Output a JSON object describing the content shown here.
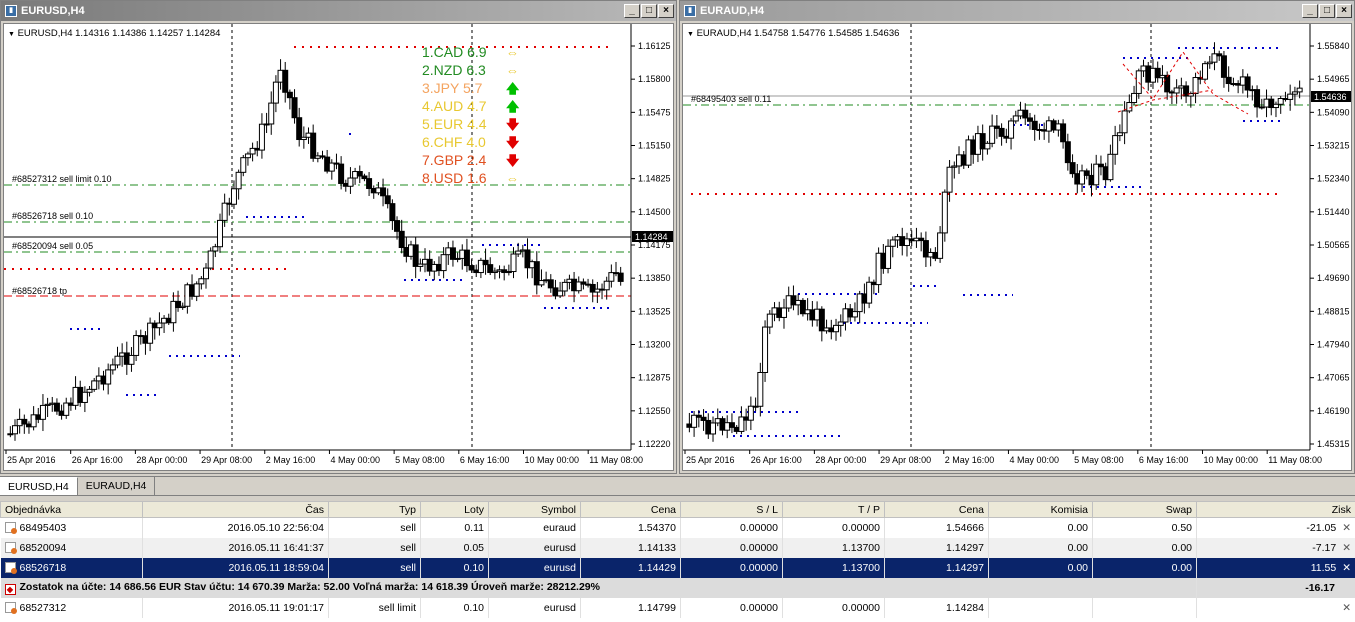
{
  "window1": {
    "title": "EURUSD,H4",
    "info": "EURUSD,H4  1.14316 1.14386 1.14257 1.14284",
    "price_tag": "1.14284",
    "yticks": [
      "1.16125",
      "1.15800",
      "1.15475",
      "1.15150",
      "1.14825",
      "1.14500",
      "1.14175",
      "1.13850",
      "1.13525",
      "1.13200",
      "1.12875",
      "1.12550",
      "1.12220"
    ],
    "xticks": [
      "25 Apr 2016",
      "26 Apr 16:00",
      "28 Apr 00:00",
      "29 Apr 08:00",
      "2 May 16:00",
      "4 May 00:00",
      "5 May 08:00",
      "6 May 16:00",
      "10 May 00:00",
      "11 May 08:00"
    ],
    "order_labels": [
      "#68527312 sell limit 0.10",
      "#68526718 sell 0.10",
      "#68520094 sell 0.05",
      "#68526718 tp"
    ],
    "strength": [
      {
        "label": "1.CAD 6.9",
        "color": "#228b22",
        "arrow": "⇔",
        "acolor": "#e8c830"
      },
      {
        "label": "2.NZD 6.3",
        "color": "#228b22",
        "arrow": "⇔",
        "acolor": "#e8c830"
      },
      {
        "label": "3.JPY  5.7",
        "color": "#f4a460",
        "arrow": "🡅",
        "acolor": "#00c000"
      },
      {
        "label": "4.AUD 4.7",
        "color": "#e8c830",
        "arrow": "🡅",
        "acolor": "#00c000"
      },
      {
        "label": "5.EUR 4.4",
        "color": "#e8c830",
        "arrow": "🡇",
        "acolor": "#e00000"
      },
      {
        "label": "6.CHF 4.0",
        "color": "#e8c830",
        "arrow": "🡇",
        "acolor": "#e00000"
      },
      {
        "label": "7.GBP 2.4",
        "color": "#e05020",
        "arrow": "🡇",
        "acolor": "#e00000"
      },
      {
        "label": "8.USD 1.6",
        "color": "#e05020",
        "arrow": "⇔",
        "acolor": "#e8c830"
      }
    ]
  },
  "window2": {
    "title": "EURAUD,H4",
    "info": "EURAUD,H4  1.54758 1.54776 1.54585 1.54636",
    "price_tag": "1.54636",
    "yticks": [
      "1.55840",
      "1.54965",
      "1.54090",
      "1.53215",
      "1.52340",
      "1.51440",
      "1.50565",
      "1.49690",
      "1.48815",
      "1.47940",
      "1.47065",
      "1.46190",
      "1.45315"
    ],
    "xticks": [
      "25 Apr 2016",
      "26 Apr 16:00",
      "28 Apr 00:00",
      "29 Apr 08:00",
      "2 May 16:00",
      "4 May 00:00",
      "5 May 08:00",
      "6 May 16:00",
      "10 May 00:00",
      "11 May 08:00"
    ],
    "order_label": "#68495403 sell 0.11"
  },
  "tabs": [
    "EURUSD,H4",
    "EURAUD,H4"
  ],
  "terminal": {
    "headers": [
      "Objednávka",
      "Čas",
      "Typ",
      "Loty",
      "Symbol",
      "Cena",
      "S / L",
      "T / P",
      "Cena",
      "Komisia",
      "Swap",
      "Zisk"
    ],
    "rows": [
      {
        "order": "68495403",
        "time": "2016.05.10 22:56:04",
        "type": "sell",
        "lots": "0.11",
        "symbol": "euraud",
        "price": "1.54370",
        "sl": "0.00000",
        "tp": "0.00000",
        "cur": "1.54666",
        "comm": "0.00",
        "swap": "0.50",
        "profit": "-21.05"
      },
      {
        "order": "68520094",
        "time": "2016.05.11 16:41:37",
        "type": "sell",
        "lots": "0.05",
        "symbol": "eurusd",
        "price": "1.14133",
        "sl": "0.00000",
        "tp": "1.13700",
        "cur": "1.14297",
        "comm": "0.00",
        "swap": "0.00",
        "profit": "-7.17"
      },
      {
        "order": "68526718",
        "time": "2016.05.11 18:59:04",
        "type": "sell",
        "lots": "0.10",
        "symbol": "eurusd",
        "price": "1.14429",
        "sl": "0.00000",
        "tp": "1.13700",
        "cur": "1.14297",
        "comm": "0.00",
        "swap": "0.00",
        "profit": "11.55"
      }
    ],
    "summary": "Zostatok na účte: 14 686.56 EUR  Stav účtu: 14 670.39  Marža: 52.00  Voľná marža: 14 618.39  Úroveň marže: 28212.29%",
    "summary_profit": "-16.17",
    "pending": {
      "order": "68527312",
      "time": "2016.05.11 19:01:17",
      "type": "sell limit",
      "lots": "0.10",
      "symbol": "eurusd",
      "price": "1.14799",
      "sl": "0.00000",
      "tp": "0.00000",
      "cur": "1.14284"
    }
  }
}
